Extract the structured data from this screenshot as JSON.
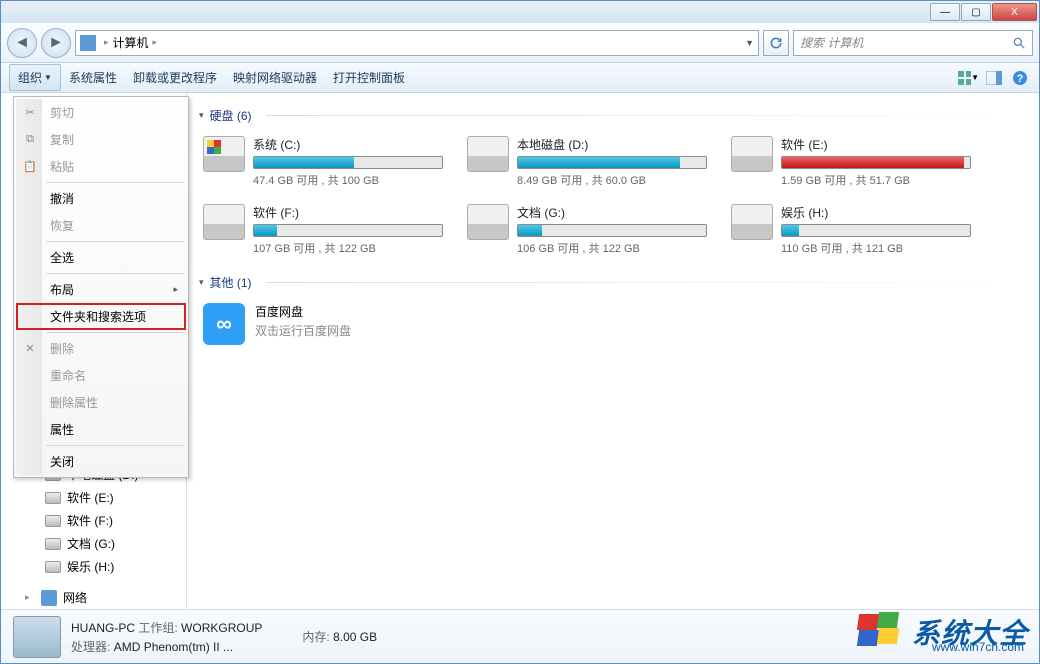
{
  "titlebar": {
    "min": "—",
    "max": "▢",
    "close": "X"
  },
  "nav": {
    "location": "计算机",
    "search_placeholder": "搜索 计算机"
  },
  "toolbar": {
    "organize": "组织",
    "items": [
      "系统属性",
      "卸载或更改程序",
      "映射网络驱动器",
      "打开控制面板"
    ]
  },
  "context_menu": {
    "items": [
      {
        "label": "剪切",
        "icon": "✂",
        "disabled": true
      },
      {
        "label": "复制",
        "icon": "⧉",
        "disabled": true
      },
      {
        "label": "粘贴",
        "icon": "📋",
        "disabled": true,
        "sep_after": true
      },
      {
        "label": "撤消"
      },
      {
        "label": "恢复",
        "disabled": true,
        "sep_after": true
      },
      {
        "label": "全选",
        "sep_after": true
      },
      {
        "label": "布局",
        "submenu": true
      },
      {
        "label": "文件夹和搜索选项",
        "highlight": true,
        "sep_after": true
      },
      {
        "label": "删除",
        "icon": "✕",
        "disabled": true
      },
      {
        "label": "重命名",
        "disabled": true
      },
      {
        "label": "删除属性",
        "disabled": true
      },
      {
        "label": "属性",
        "sep_after": true
      },
      {
        "label": "关闭"
      }
    ]
  },
  "tree": {
    "computer": "计算机",
    "items": [
      "系统 (C:)",
      "本地磁盘 (D:)",
      "软件 (E:)",
      "软件 (F:)",
      "文档 (G:)",
      "娱乐 (H:)"
    ],
    "network": "网络"
  },
  "main": {
    "group_drives": "硬盘 (6)",
    "drives": [
      {
        "name": "系统 (C:)",
        "free": "47.4 GB 可用 , 共 100 GB",
        "pct": 53,
        "os": true
      },
      {
        "name": "本地磁盘 (D:)",
        "free": "8.49 GB 可用 , 共 60.0 GB",
        "pct": 86
      },
      {
        "name": "软件 (E:)",
        "free": "1.59 GB 可用 , 共 51.7 GB",
        "pct": 97,
        "red": true
      },
      {
        "name": "软件 (F:)",
        "free": "107 GB 可用 , 共 122 GB",
        "pct": 12
      },
      {
        "name": "文档 (G:)",
        "free": "106 GB 可用 , 共 122 GB",
        "pct": 13
      },
      {
        "name": "娱乐 (H:)",
        "free": "110 GB 可用 , 共 121 GB",
        "pct": 9
      }
    ],
    "group_other": "其他 (1)",
    "other": {
      "name": "百度网盘",
      "desc": "双击运行百度网盘"
    }
  },
  "status": {
    "pc": "HUANG-PC",
    "workgroup_label": "工作组:",
    "workgroup": "WORKGROUP",
    "cpu_label": "处理器:",
    "cpu": "AMD Phenom(tm) II ...",
    "mem_label": "内存:",
    "mem": "8.00 GB"
  },
  "watermark": {
    "text": "系统大全",
    "url": "www.win7cn.com"
  }
}
